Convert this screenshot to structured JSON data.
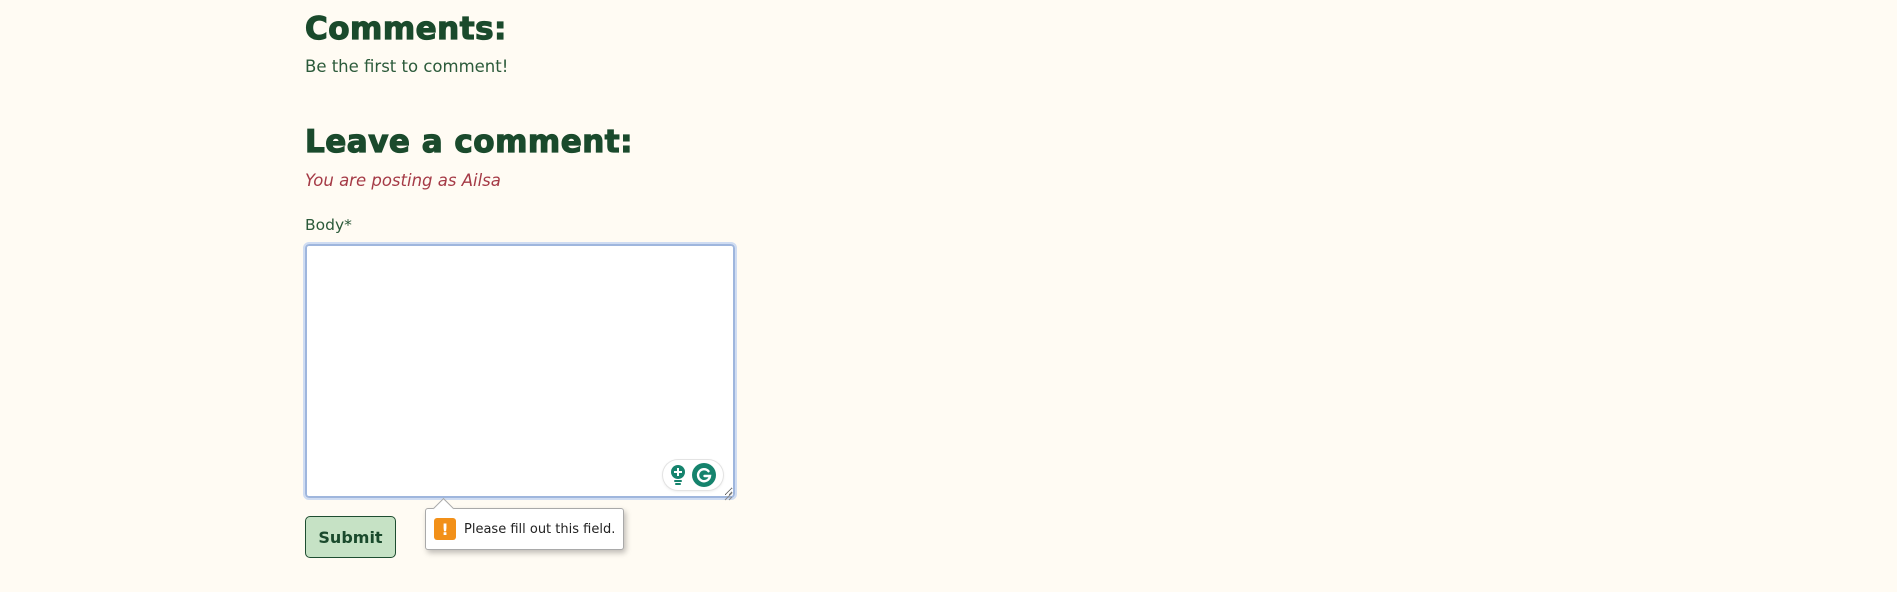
{
  "comments": {
    "title": "Comments:",
    "empty_message": "Be the first to comment!"
  },
  "leave_comment": {
    "title": "Leave a comment:",
    "posting_as": "You are posting as Ailsa",
    "body_label": "Body*",
    "body_value": "",
    "submit_label": "Submit"
  },
  "validation": {
    "message": "Please fill out this field.",
    "icon": "warning-icon",
    "icon_glyph": "!",
    "color": "#f29019"
  },
  "grammarly": {
    "icons": [
      "lightbulb-icon",
      "grammarly-logo-icon"
    ],
    "color": "#15836d"
  },
  "colors": {
    "background": "#fffbf3",
    "heading": "#1a4a2c",
    "text": "#2b5a3a",
    "accent": "#a53a46",
    "button_bg": "#c6e2c5"
  }
}
